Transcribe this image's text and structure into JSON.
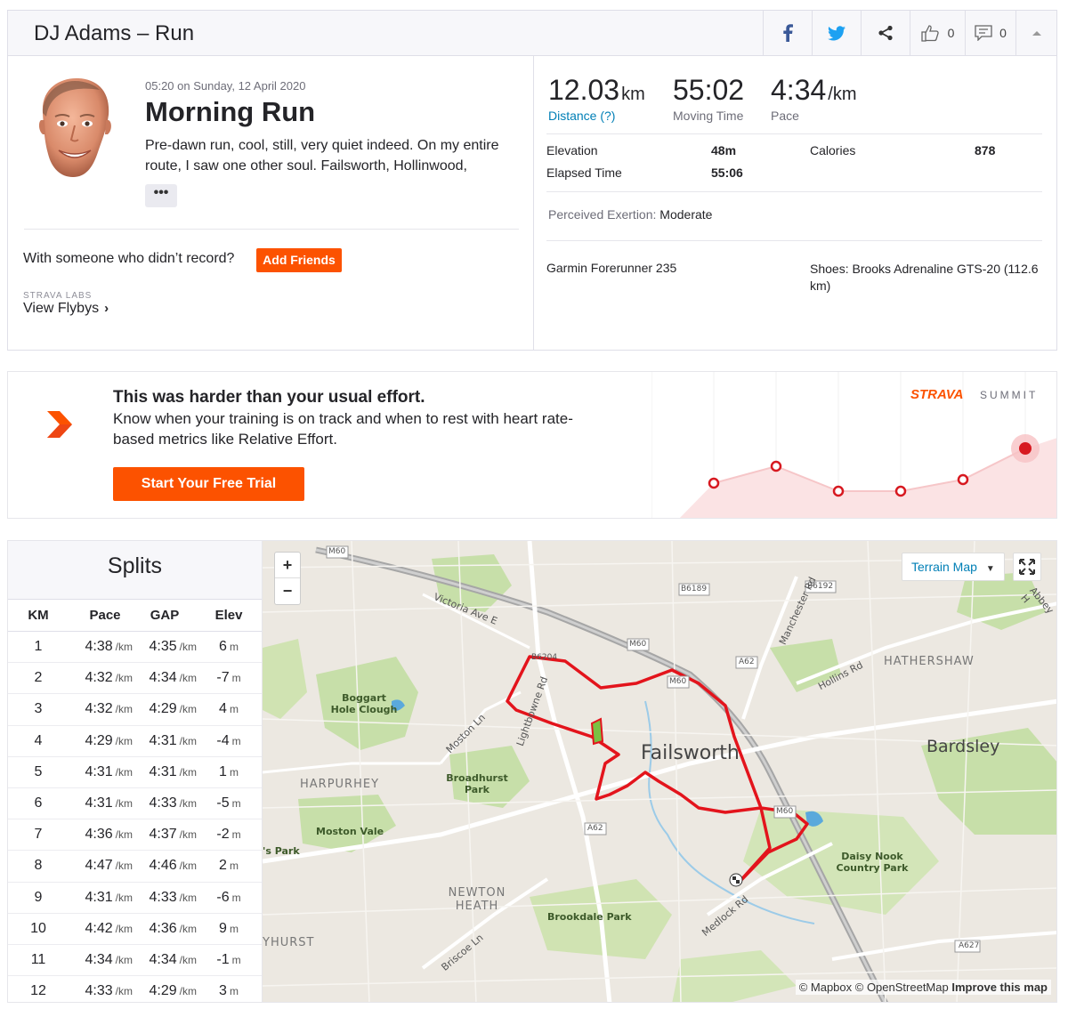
{
  "header": {
    "title": "DJ Adams – Run",
    "kudos_count": "0",
    "comments_count": "0",
    "icons": [
      "facebook-icon",
      "twitter-icon",
      "share-icon",
      "thumbs-up-icon",
      "comment-icon",
      "caret-up-icon"
    ]
  },
  "activity": {
    "date": "05:20 on Sunday, 12 April 2020",
    "title": "Morning Run",
    "description": "Pre-dawn run, cool, still, very quiet indeed. On my entire route, I saw one other soul. Failsworth, Hollinwood,",
    "more_label": "•••",
    "with_someone": "With someone who didn’t record?",
    "add_friends": "Add Friends",
    "labs_label": "STRAVA LABS",
    "flybys_label": "View Flybys"
  },
  "stats": {
    "distance": {
      "value": "12.03",
      "unit": "km",
      "label": "Distance (?)"
    },
    "moving_time": {
      "value": "55:02",
      "label": "Moving Time"
    },
    "pace": {
      "value": "4:34",
      "unit": "/km",
      "label": "Pace"
    },
    "elevation_label": "Elevation",
    "elevation_value": "48m",
    "calories_label": "Calories",
    "calories_value": "878",
    "elapsed_label": "Elapsed Time",
    "elapsed_value": "55:06",
    "perceived_label": "Perceived Exertion:",
    "perceived_value": "Moderate",
    "device": "Garmin Forerunner 235",
    "shoes": "Shoes: Brooks Adrenaline GTS-20 (112.6 km)"
  },
  "upsell": {
    "title": "This was harder than your usual effort.",
    "text": "Know when your training is on track and when to rest with heart rate-based metrics like Relative Effort.",
    "button": "Start Your Free Trial",
    "brand": "STRAVA",
    "brand_sub": "SUMMIT"
  },
  "splits": {
    "title": "Splits",
    "headers": [
      "KM",
      "Pace",
      "GAP",
      "Elev"
    ],
    "pace_unit": "/km",
    "elev_unit": "m",
    "rows": [
      {
        "km": "1",
        "pace": "4:38",
        "gap": "4:35",
        "elev": "6"
      },
      {
        "km": "2",
        "pace": "4:32",
        "gap": "4:34",
        "elev": "-7"
      },
      {
        "km": "3",
        "pace": "4:32",
        "gap": "4:29",
        "elev": "4"
      },
      {
        "km": "4",
        "pace": "4:29",
        "gap": "4:31",
        "elev": "-4"
      },
      {
        "km": "5",
        "pace": "4:31",
        "gap": "4:31",
        "elev": "1"
      },
      {
        "km": "6",
        "pace": "4:31",
        "gap": "4:33",
        "elev": "-5"
      },
      {
        "km": "7",
        "pace": "4:36",
        "gap": "4:37",
        "elev": "-2"
      },
      {
        "km": "8",
        "pace": "4:47",
        "gap": "4:46",
        "elev": "2"
      },
      {
        "km": "9",
        "pace": "4:31",
        "gap": "4:33",
        "elev": "-6"
      },
      {
        "km": "10",
        "pace": "4:42",
        "gap": "4:36",
        "elev": "9"
      },
      {
        "km": "11",
        "pace": "4:34",
        "gap": "4:34",
        "elev": "-1"
      },
      {
        "km": "12",
        "pace": "4:33",
        "gap": "4:29",
        "elev": "3"
      }
    ]
  },
  "map": {
    "zoom_in": "+",
    "zoom_out": "−",
    "terrain_label": "Terrain Map",
    "attribution": "© Mapbox © OpenStreetMap",
    "improve": "Improve this map",
    "labels": {
      "failsworth": "Failsworth",
      "bardsley": "Bardsley",
      "hathershaw": "HATHERSHAW",
      "harpurhey": "HARPURHEY",
      "boggart": "Boggart Hole Clough",
      "broadhurst": "Broadhurst Park",
      "moston_vale": "Moston Vale",
      "newton_heath": "NEWTON HEATH",
      "brookdale": "Brookdale Park",
      "daisy_nook": "Daisy Nook Country Park",
      "victoria": "Victoria Ave E",
      "moston_ln": "Moston Ln",
      "lightbowne": "Lightbowne Rd",
      "manchester_rd": "Manchester Rd",
      "hollins_rd": "Hollins Rd",
      "medlock_rd": "Medlock Rd",
      "briscoe_ln": "Briscoe Ln",
      "abbey_h": "Abbey H",
      "s_park": "'s Park",
      "yhurst": "YHURST",
      "m60": "M60",
      "b6189": "B6189",
      "b6192": "B6192",
      "a62": "A62",
      "a627": "A627",
      "b6204": "B6204"
    }
  },
  "colors": {
    "brand_orange": "#fc5200",
    "link_blue": "#007fb6",
    "route_red": "#e3141c"
  }
}
